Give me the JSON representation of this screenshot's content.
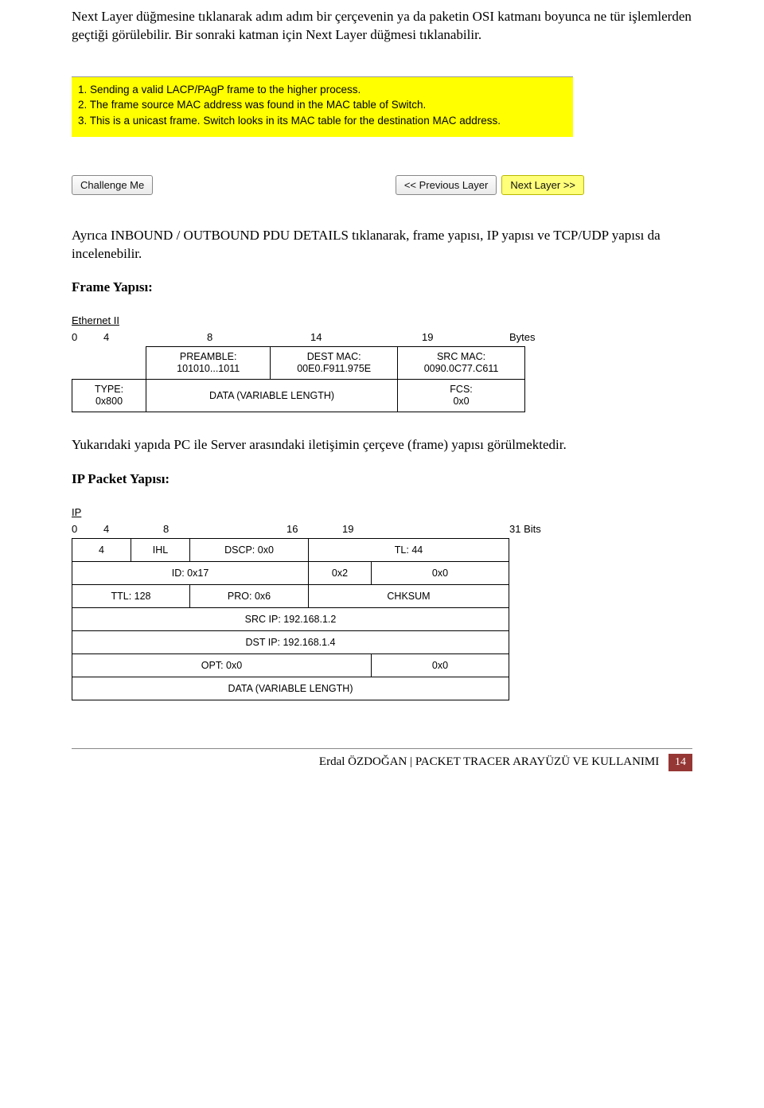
{
  "body": {
    "p1": "Next Layer düğmesine tıklanarak adım adım bir çerçevenin ya da paketin OSI katmanı boyunca ne tür işlemlerden geçtiği görülebilir. Bir sonraki katman için Next Layer düğmesi tıklanabilir.",
    "highlight_lines": [
      "1. Sending a valid LACP/PAgP frame to the higher process.",
      "2. The frame source MAC address was found in the MAC table of Switch.",
      "3. This is a unicast frame. Switch looks in its MAC table for the destination MAC address."
    ],
    "buttons": {
      "challenge": "Challenge Me",
      "prev": "<< Previous Layer",
      "next": "Next Layer >>"
    },
    "p2": "Ayrıca INBOUND / OUTBOUND PDU DETAILS tıklanarak, frame yapısı, IP yapısı ve TCP/UDP yapısı da incelenebilir.",
    "h_frame": "Frame Yapısı:",
    "eth": {
      "title": "Ethernet II",
      "ruler": [
        "0",
        "4",
        "8",
        "14",
        "19",
        "Bytes"
      ],
      "row1": [
        {
          "l1": "PREAMBLE:",
          "l2": "101010...1011"
        },
        {
          "l1": "DEST MAC:",
          "l2": "00E0.F911.975E"
        },
        {
          "l1": "SRC MAC:",
          "l2": "0090.0C77.C611"
        }
      ],
      "row2": [
        {
          "l1": "TYPE:",
          "l2": "0x800"
        },
        {
          "l1": "DATA (VARIABLE LENGTH)",
          "l2": ""
        },
        {
          "l1": "FCS:",
          "l2": "0x0"
        }
      ]
    },
    "p3": "Yukarıdaki yapıda PC ile Server arasındaki iletişimin çerçeve (frame) yapısı görülmektedir.",
    "h_ip": "IP Packet Yapısı:",
    "ip": {
      "title": "IP",
      "ruler": [
        "0",
        "4",
        "8",
        "16",
        "19",
        "31 Bits"
      ],
      "rows": [
        [
          "4",
          "IHL",
          "DSCP: 0x0",
          "TL: 44"
        ],
        [
          "ID: 0x17",
          "0x2",
          "0x0"
        ],
        [
          "TTL: 128",
          "PRO: 0x6",
          "CHKSUM"
        ],
        [
          "SRC IP: 192.168.1.2"
        ],
        [
          "DST IP: 192.168.1.4"
        ],
        [
          "OPT: 0x0",
          "0x0"
        ],
        [
          "DATA (VARIABLE LENGTH)"
        ]
      ]
    }
  },
  "footer": {
    "text": "Erdal ÖZDOĞAN | PACKET TRACER ARAYÜZÜ VE KULLANIMI",
    "page": "14"
  }
}
